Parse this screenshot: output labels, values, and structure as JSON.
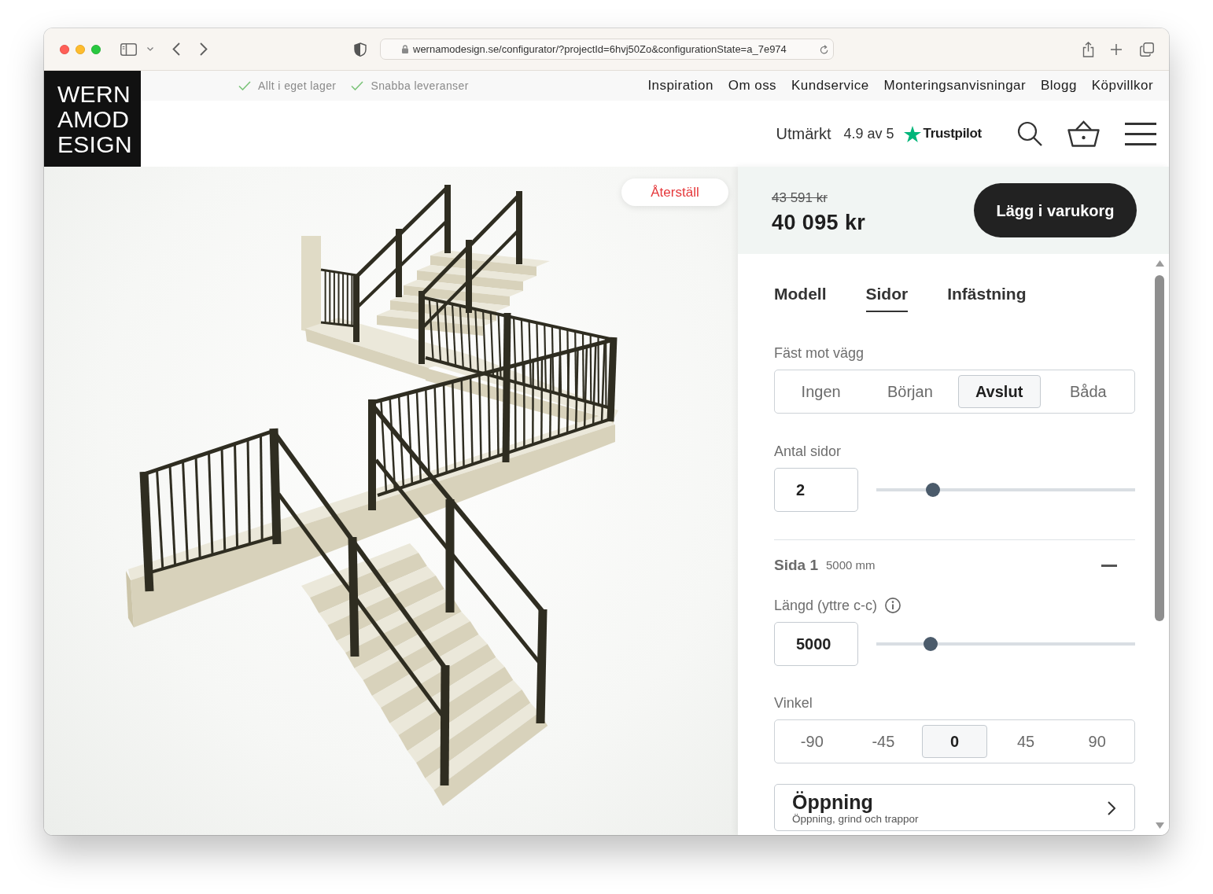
{
  "browser": {
    "url": "wernamodesign.se/configurator/?projectId=6hvj50Zo&configurationState=a_7e974"
  },
  "header": {
    "logo_lines": [
      "WERN",
      "AMOD",
      "ESIGN"
    ],
    "usps": [
      "Allt i eget lager",
      "Snabba leveranser"
    ],
    "nav": [
      "Inspiration",
      "Om oss",
      "Kundservice",
      "Monteringsanvisningar",
      "Blogg",
      "Köpvillkor"
    ],
    "rating": {
      "label": "Utmärkt",
      "score": "4.9 av 5",
      "brand": "Trustpilot"
    }
  },
  "viewer": {
    "reset_button": "Återställ"
  },
  "summary": {
    "old_price": "43 591 kr",
    "price": "40 095 kr",
    "cart_button": "Lägg i varukorg"
  },
  "tabs": [
    {
      "label": "Modell",
      "selected": false
    },
    {
      "label": "Sidor",
      "selected": true
    },
    {
      "label": "Infästning",
      "selected": false
    }
  ],
  "settings": [
    {
      "kind": "segmented",
      "label": "Fäst mot vägg",
      "options": [
        {
          "label": "Ingen",
          "selected": false
        },
        {
          "label": "Början",
          "selected": false
        },
        {
          "label": "Avslut",
          "selected": true
        },
        {
          "label": "Båda",
          "selected": false
        }
      ]
    },
    {
      "kind": "slider",
      "label": "Antal sidor",
      "value": "2",
      "level": 0.22
    },
    {
      "kind": "side_header",
      "title": "Sida 1",
      "detail": "5000 mm",
      "expanded": true
    },
    {
      "kind": "slider",
      "label": "Längd (yttre c-c)",
      "info": true,
      "value": "5000",
      "level": 0.21
    },
    {
      "kind": "segmented",
      "label": "Vinkel",
      "options": [
        {
          "label": "-90",
          "selected": false
        },
        {
          "label": "-45",
          "selected": false
        },
        {
          "label": "0",
          "selected": true
        },
        {
          "label": "45",
          "selected": false
        },
        {
          "label": "90",
          "selected": false
        }
      ]
    },
    {
      "kind": "link_card",
      "title": "Öppning",
      "subtitle": "Öppning, grind och trappor"
    }
  ]
}
